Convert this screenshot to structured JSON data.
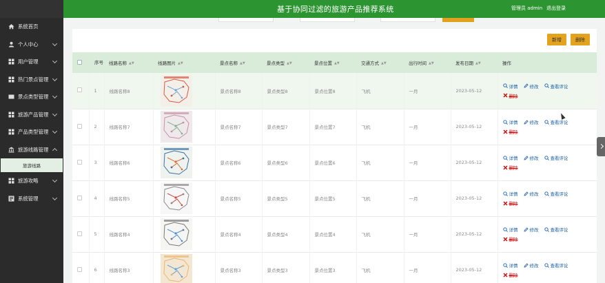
{
  "header": {
    "title": "基于协同过滤的旅游产品推荐系统",
    "user": "管理员 admin",
    "logout": "退出登录"
  },
  "sidebar": {
    "items": [
      {
        "label": "系统首页",
        "icon": "home-icon"
      },
      {
        "label": "个人中心",
        "icon": "person-icon",
        "chevron": "down"
      },
      {
        "label": "用户管理",
        "icon": "grid-icon",
        "chevron": "down"
      },
      {
        "label": "热门景点管理",
        "icon": "grid-icon",
        "chevron": "down"
      },
      {
        "label": "景点类型管理",
        "icon": "grid-icon",
        "chevron": "down"
      },
      {
        "label": "旅游产品管理",
        "icon": "grid-icon",
        "chevron": "down"
      },
      {
        "label": "产品类型管理",
        "icon": "grid-icon",
        "chevron": "down"
      },
      {
        "label": "旅游线路管理",
        "icon": "bank-icon",
        "chevron": "up"
      }
    ],
    "subitem": "旅游线路",
    "items_after": [
      {
        "label": "旅游攻略",
        "icon": "grid-icon",
        "chevron": "down"
      },
      {
        "label": "系统管理",
        "icon": "grid-icon",
        "chevron": "down"
      }
    ]
  },
  "toolbar": {
    "add": "新增",
    "delete": "删除"
  },
  "table": {
    "columns": [
      "序号",
      "线路名称",
      "线路图片",
      "景点名称",
      "景点类型",
      "景点位置",
      "交通方式",
      "出行时间",
      "发布日期",
      "操作"
    ],
    "rows": [
      {
        "no": "1",
        "route": "线路名称8",
        "spot": "景点名称8",
        "type": "景点类型8",
        "location": "景点位置8",
        "transport": "飞机",
        "time": "一月",
        "date": "2023-05-12"
      },
      {
        "no": "2",
        "route": "线路名称7",
        "spot": "景点名称7",
        "type": "景点类型7",
        "location": "景点位置7",
        "transport": "飞机",
        "time": "一月",
        "date": "2023-05-12"
      },
      {
        "no": "3",
        "route": "线路名称6",
        "spot": "景点名称6",
        "type": "景点类型6",
        "location": "景点位置6",
        "transport": "飞机",
        "time": "一月",
        "date": "2023-05-12"
      },
      {
        "no": "4",
        "route": "线路名称5",
        "spot": "景点名称5",
        "type": "景点类型5",
        "location": "景点位置5",
        "transport": "飞机",
        "time": "一月",
        "date": "2023-05-12"
      },
      {
        "no": "5",
        "route": "线路名称4",
        "spot": "景点名称4",
        "type": "景点类型4",
        "location": "景点位置4",
        "transport": "飞机",
        "time": "一月",
        "date": "2023-05-12"
      },
      {
        "no": "6",
        "route": "线路名称3",
        "spot": "景点名称3",
        "type": "景点类型3",
        "location": "景点位置3",
        "transport": "飞机",
        "time": "一月",
        "date": "2023-05-12"
      }
    ],
    "ops": {
      "detail": "详情",
      "edit": "修改",
      "reviews": "查看评论",
      "delete": "删除"
    }
  },
  "colors": {
    "primary": "#2c9532",
    "accent": "#e4a31e",
    "sidebar": "#2b2b2b",
    "link": "#1a5fa8",
    "danger": "#cc0000"
  }
}
